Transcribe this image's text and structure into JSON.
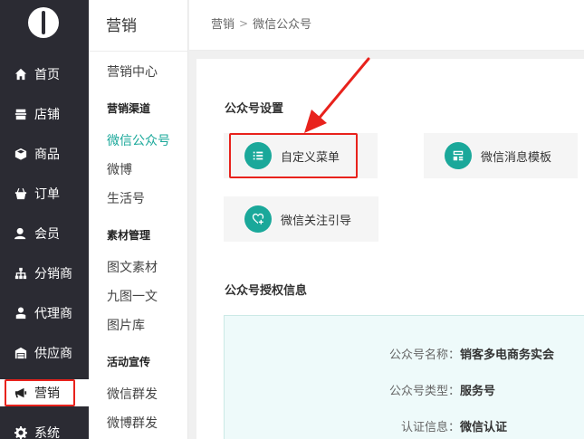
{
  "nav": {
    "items": [
      {
        "label": "首页",
        "icon": "home-icon"
      },
      {
        "label": "店铺",
        "icon": "store-icon"
      },
      {
        "label": "商品",
        "icon": "box-icon"
      },
      {
        "label": "订单",
        "icon": "basket-icon"
      },
      {
        "label": "会员",
        "icon": "member-icon"
      },
      {
        "label": "分销商",
        "icon": "sitemap-icon"
      },
      {
        "label": "代理商",
        "icon": "agent-icon"
      },
      {
        "label": "供应商",
        "icon": "warehouse-icon"
      },
      {
        "label": "营销",
        "icon": "megaphone-icon"
      },
      {
        "label": "系统",
        "icon": "gear-icon"
      }
    ]
  },
  "subnav": {
    "title": "营销",
    "marketing_center": "营销中心",
    "group_channels": "营销渠道",
    "wechat_official": "微信公众号",
    "weibo": "微博",
    "life_account": "生活号",
    "group_materials": "素材管理",
    "image_text": "图文素材",
    "nine_grid": "九图一文",
    "gallery": "图片库",
    "group_promo": "活动宣传",
    "wechat_mass": "微信群发",
    "weibo_mass": "微博群发"
  },
  "breadcrumb": {
    "root": "营销",
    "sep": ">",
    "current": "微信公众号"
  },
  "settings": {
    "title": "公众号设置",
    "cards": [
      {
        "label": "自定义菜单",
        "icon": "list-icon"
      },
      {
        "label": "微信消息模板",
        "icon": "template-icon"
      },
      {
        "label": "微信关注引导",
        "icon": "follow-guide-icon"
      }
    ]
  },
  "auth": {
    "title": "公众号授权信息",
    "rows": [
      {
        "key": "公众号名称：",
        "value": "销客多电商务实会"
      },
      {
        "key": "公众号类型：",
        "value": "服务号"
      },
      {
        "key": "认证信息：",
        "value": "微信认证"
      }
    ]
  },
  "colors": {
    "accent": "#1aa89a",
    "nav_bg": "#2b2b33",
    "highlight": "#e8221c"
  }
}
